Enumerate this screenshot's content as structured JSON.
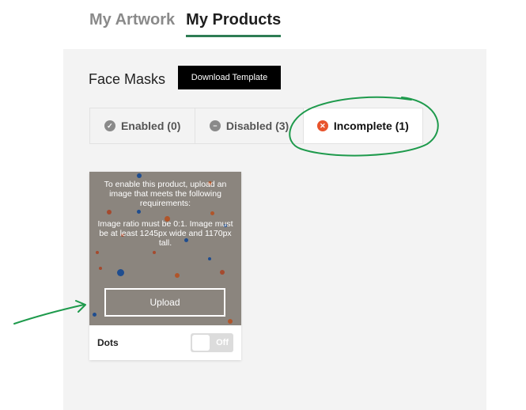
{
  "top_tabs": [
    {
      "label": "My Artwork",
      "active": false
    },
    {
      "label": "My Products",
      "active": true
    }
  ],
  "section": {
    "title": "Face Masks",
    "download_label": "Download Template"
  },
  "status_tabs": [
    {
      "label": "Enabled (0)",
      "icon": "check-circle-icon"
    },
    {
      "label": "Disabled (3)",
      "icon": "minus-circle-icon"
    },
    {
      "label": "Incomplete (1)",
      "icon": "x-circle-icon"
    }
  ],
  "product_card": {
    "message": "To enable this product, upload an image that meets the following requirements:",
    "requirements": "Image ratio must be 0:1. Image must be at least 1245px wide and 1170px tall.",
    "upload_label": "Upload",
    "name": "Dots",
    "toggle_label": "Off"
  },
  "colors": {
    "accent_green": "#2e7d54",
    "incomplete_red": "#e8542c",
    "annotation_green": "#1e9a4c",
    "image_bg": "#8b857e"
  }
}
